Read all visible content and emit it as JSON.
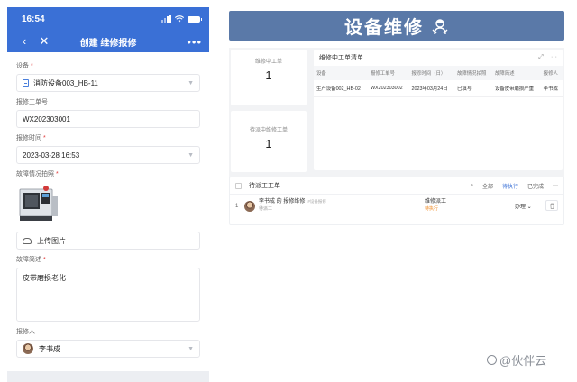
{
  "mobile": {
    "status_time": "16:54",
    "nav": {
      "title": "创建 维修报修",
      "back_icon": "chevron-left-icon",
      "close_icon": "close-icon",
      "more_icon": "more-icon"
    },
    "form": {
      "device_label": "设备",
      "device_value": "消防设备003_HB-11",
      "order_no_label": "报修工单号",
      "order_no_value": "WX202303001",
      "time_label": "报修时间",
      "time_value": "2023-03-28 16:53",
      "photo_label": "故障情况拍照",
      "upload_label": "上传图片",
      "desc_label": "故障简述",
      "desc_value": "皮带磨损老化",
      "reporter_label": "报修人",
      "reporter_value": "李书成",
      "required_mark": "*"
    }
  },
  "dashboard": {
    "title": "设备维修",
    "stats": [
      {
        "label": "维修中工单",
        "value": "1"
      },
      {
        "label": "待派中维修工单",
        "value": "1"
      }
    ],
    "table": {
      "title": "维修中工单清单",
      "columns": [
        "设备",
        "报修工单号",
        "报修时间（日）",
        "故障情况拍照",
        "故障简述",
        "报修人"
      ],
      "rows": [
        [
          "生产设备002_HB-02",
          "WX202303002",
          "2023年03月24日",
          "已填写",
          "设备皮带磨损严重",
          "李书成"
        ]
      ]
    },
    "list": {
      "title": "待派工工单",
      "filters": [
        "全部",
        "待执行",
        "已完成"
      ],
      "active_filter": "待执行",
      "items": [
        {
          "index": "1",
          "title": "李书成 的 报修维修",
          "tag": "#设备报修",
          "sub": "待派工",
          "node": "维修派工",
          "state": "待执行",
          "action": "办理"
        }
      ]
    }
  },
  "watermark": "@伙伴云",
  "colors": {
    "primary": "#3a70d6",
    "banner": "#5a79a8",
    "required": "#e03b3b",
    "pending": "#f08a24"
  }
}
